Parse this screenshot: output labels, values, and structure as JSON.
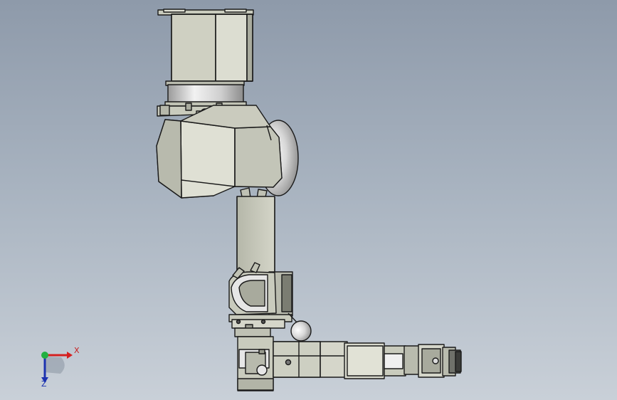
{
  "viewport": {
    "background_top": "#8e9aaa",
    "background_bottom": "#c9d0d8"
  },
  "model": {
    "part_fill": "#c9cbbd",
    "part_shade": "#9fa294",
    "part_light": "#e1e2d6",
    "edge_color": "#1a1a1a",
    "chrome_fill": "#dcdcdc"
  },
  "triad": {
    "x_label": "X",
    "z_label": "Z",
    "x_color": "#d42020",
    "y_color": "#22b040",
    "z_color": "#1c32b0"
  }
}
